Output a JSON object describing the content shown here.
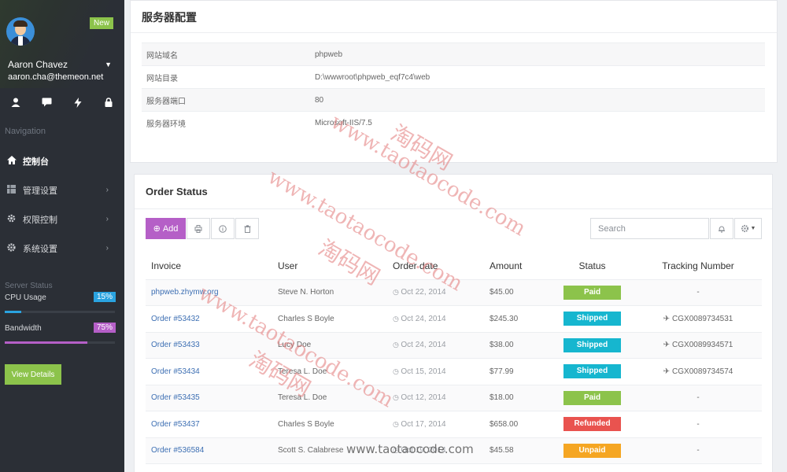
{
  "sidebar": {
    "badge": "New",
    "user_name": "Aaron Chavez",
    "user_email": "aaron.cha@themeon.net",
    "quick_icons": [
      "user-icon",
      "chat-icon",
      "bolt-icon",
      "lock-icon"
    ],
    "nav_title": "Navigation",
    "nav_items": [
      {
        "label": "控制台",
        "icon": "home-icon",
        "active": true
      },
      {
        "label": "管理设置",
        "icon": "grid-icon"
      },
      {
        "label": "权限控制",
        "icon": "cog-icon"
      },
      {
        "label": "系统设置",
        "icon": "gear-icon"
      }
    ],
    "server_status_title": "Server Status",
    "cpu": {
      "label": "CPU Usage",
      "value": "15%",
      "fraction": 0.15,
      "color": "#2aa3e0"
    },
    "bandwidth": {
      "label": "Bandwidth",
      "value": "75%",
      "fraction": 0.75,
      "color": "#b55fc7"
    },
    "view_details": "View Details"
  },
  "server_config": {
    "title": "服务器配置",
    "rows": [
      {
        "key": "网站域名",
        "value": "phpweb"
      },
      {
        "key": "网站目录",
        "value": "D:\\wwwroot\\phpweb_eqf7c4\\web"
      },
      {
        "key": "服务器端口",
        "value": "80"
      },
      {
        "key": "服务器环境",
        "value": "Microsoft-IIS/7.5"
      }
    ]
  },
  "orders": {
    "title": "Order Status",
    "add_label": "Add",
    "search_placeholder": "Search",
    "columns": [
      "Invoice",
      "User",
      "Order date",
      "Amount",
      "Status",
      "Tracking Number"
    ],
    "rows": [
      {
        "invoice": "phpweb.zhymw.org",
        "user": "Steve N. Horton",
        "date": "Oct 22, 2014",
        "amount": "$45.00",
        "status": "Paid",
        "tracking": "-"
      },
      {
        "invoice": "Order #53432",
        "user": "Charles S Boyle",
        "date": "Oct 24, 2014",
        "amount": "$245.30",
        "status": "Shipped",
        "tracking": "CGX0089734531"
      },
      {
        "invoice": "Order #53433",
        "user": "Lucy Doe",
        "date": "Oct 24, 2014",
        "amount": "$38.00",
        "status": "Shipped",
        "tracking": "CGX0089934571"
      },
      {
        "invoice": "Order #53434",
        "user": "Teresa L. Doe",
        "date": "Oct 15, 2014",
        "amount": "$77.99",
        "status": "Shipped",
        "tracking": "CGX0089734574"
      },
      {
        "invoice": "Order #53435",
        "user": "Teresa L. Doe",
        "date": "Oct 12, 2014",
        "amount": "$18.00",
        "status": "Paid",
        "tracking": "-"
      },
      {
        "invoice": "Order #53437",
        "user": "Charles S Boyle",
        "date": "Oct 17, 2014",
        "amount": "$658.00",
        "status": "Refunded",
        "tracking": "-"
      },
      {
        "invoice": "Order #536584",
        "user": "Scott S. Calabrese",
        "date": "Oct 19, 2014",
        "amount": "$45.58",
        "status": "Unpaid",
        "tracking": "-"
      }
    ],
    "status_colors": {
      "Paid": "#8cc34b",
      "Shipped": "#16b6cf",
      "Refunded": "#e9534f",
      "Unpaid": "#f5a623"
    }
  },
  "watermark": {
    "url": "www.taotaocode.com",
    "cn": "淘码网"
  }
}
